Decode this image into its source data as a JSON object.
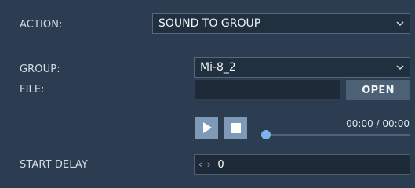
{
  "action": {
    "label": "ACTION:",
    "value": "SOUND TO GROUP"
  },
  "group": {
    "label": "GROUP:",
    "value": "Mi-8_2"
  },
  "file": {
    "label": "FILE:",
    "value": "",
    "open_label": "OPEN"
  },
  "player": {
    "time": "00:00 / 00:00",
    "progress": 0
  },
  "start_delay": {
    "label": "START DELAY",
    "value": "0",
    "arrows": "‹ ›"
  },
  "colors": {
    "background": "#2c3d52",
    "knob": "#7eb2ea",
    "button": "#7f9ab6"
  }
}
